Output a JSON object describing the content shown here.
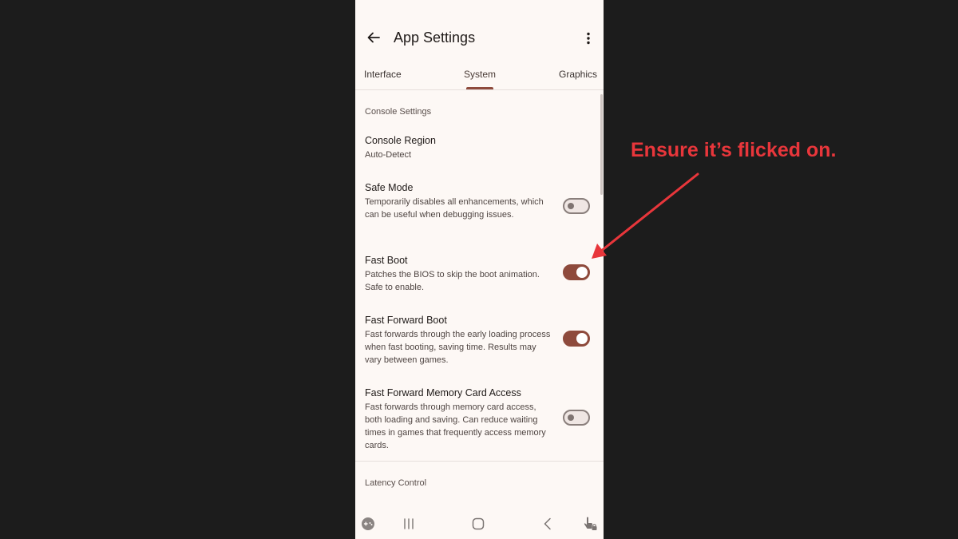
{
  "header": {
    "title": "App Settings",
    "back_icon": "arrow-left-icon",
    "more_icon": "more-vertical-icon"
  },
  "tabs": [
    {
      "label": "Interface",
      "active": false
    },
    {
      "label": "System",
      "active": true
    },
    {
      "label": "Graphics",
      "active": false
    }
  ],
  "sections": {
    "console": {
      "header": "Console Settings"
    },
    "latency": {
      "header": "Latency Control"
    }
  },
  "prefs": {
    "console_region": {
      "title": "Console Region",
      "summary": "Auto-Detect"
    },
    "safe_mode": {
      "title": "Safe Mode",
      "summary": "Temporarily disables all enhancements, which can be useful when debugging issues.",
      "enabled": false
    },
    "fast_boot": {
      "title": "Fast Boot",
      "summary": "Patches the BIOS to skip the boot animation. Safe to enable.",
      "enabled": true
    },
    "fast_forward_boot": {
      "title": "Fast Forward Boot",
      "summary": "Fast forwards through the early loading process when fast booting, saving time. Results may vary between games.",
      "enabled": true
    },
    "fast_forward_memcard": {
      "title": "Fast Forward Memory Card Access",
      "summary": "Fast forwards through memory card access, both loading and saving. Can reduce waiting times in games that frequently access memory cards.",
      "enabled": false
    }
  },
  "navbar": {
    "icons": [
      "gamepad-icon",
      "recents-icon",
      "home-icon",
      "back-icon",
      "touch-lock-icon"
    ]
  },
  "annotation": {
    "text": "Ensure it’s flicked on.",
    "color": "#e8363b"
  },
  "colors": {
    "accent": "#8e4a3c",
    "background": "#fdf8f5",
    "outside": "#1c1c1c"
  }
}
